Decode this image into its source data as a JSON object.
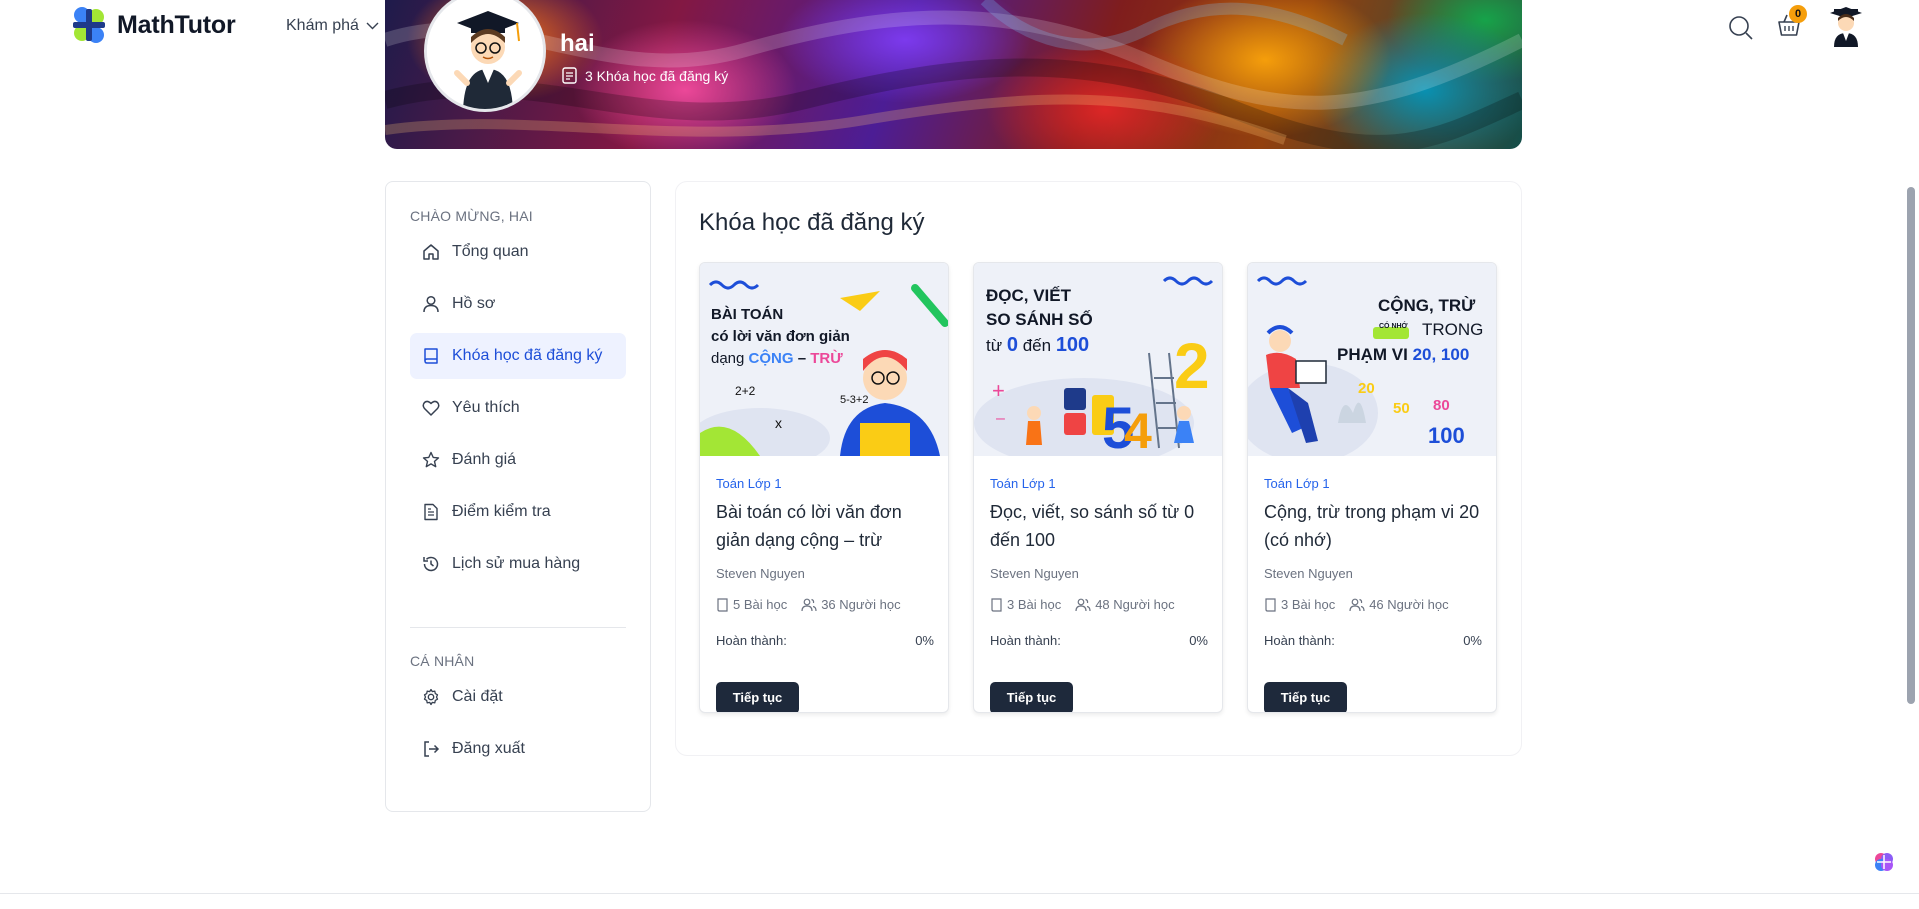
{
  "header": {
    "brand": "MathTutor",
    "explore_label": "Khám phá",
    "cart_count": "0",
    "icons": [
      "logo-icon",
      "chevron-down-icon",
      "search-icon",
      "basket-icon",
      "avatar"
    ]
  },
  "profile": {
    "name": "hai",
    "enrolled_summary": "3 Khóa học đã đăng ký"
  },
  "sidebar": {
    "welcome": "CHÀO MỪNG, HAI",
    "items": [
      {
        "label": "Tổng quan",
        "icon": "home-icon"
      },
      {
        "label": "Hồ sơ",
        "icon": "user-icon"
      },
      {
        "label": "Khóa học đã đăng ký",
        "icon": "book-icon",
        "active": true
      },
      {
        "label": "Yêu thích",
        "icon": "heart-icon"
      },
      {
        "label": "Đánh giá",
        "icon": "star-icon"
      },
      {
        "label": "Điểm kiểm tra",
        "icon": "document-icon"
      },
      {
        "label": "Lịch sử mua hàng",
        "icon": "history-icon"
      }
    ],
    "personal_title": "CÁ NHÂN",
    "personal_items": [
      {
        "label": "Cài đặt",
        "icon": "gear-icon"
      },
      {
        "label": "Đăng xuất",
        "icon": "logout-icon"
      }
    ]
  },
  "main": {
    "title": "Khóa học đã đăng ký",
    "progress_label": "Hoàn thành:",
    "continue_label": "Tiếp tục",
    "courses": [
      {
        "category": "Toán Lớp 1",
        "title": "Bài toán có lời văn đơn giản dạng cộng – trừ",
        "author": "Steven Nguyen",
        "lessons": "5 Bài học",
        "students": "36 Người học",
        "progress": "0%",
        "image_lines": [
          "BÀI TOÁN",
          "có lời văn đơn giản",
          "dạng",
          "CỘNG",
          "–",
          "TRỪ"
        ]
      },
      {
        "category": "Toán Lớp 1",
        "title": "Đọc, viết, so sánh số từ 0 đến 100",
        "author": "Steven Nguyen",
        "lessons": "3 Bài học",
        "students": "48 Người học",
        "progress": "0%",
        "image_lines": [
          "ĐỌC, VIẾT",
          "SO SÁNH SỐ",
          "từ",
          "0",
          "đến",
          "100"
        ]
      },
      {
        "category": "Toán Lớp 1",
        "title": "Cộng, trừ trong phạm vi 20 (có nhớ)",
        "author": "Steven Nguyen",
        "lessons": "3 Bài học",
        "students": "46 Người học",
        "progress": "0%",
        "image_lines": [
          "CỘNG, TRỪ",
          "CÓ NHỚ",
          "TRONG",
          "PHẠM VI",
          "20, 100",
          "20",
          "50",
          "80",
          "100"
        ]
      }
    ]
  },
  "colors": {
    "accent": "#2563eb",
    "button": "#1e293b",
    "active_bg": "#eef2ff",
    "badge": "#f59e0b"
  }
}
